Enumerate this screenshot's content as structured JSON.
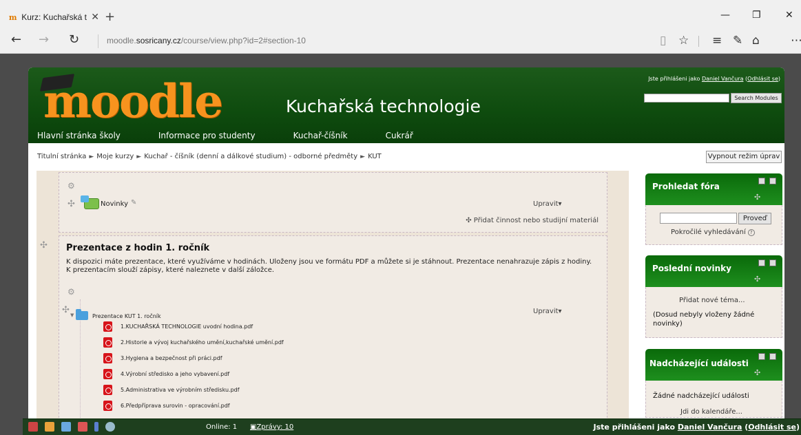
{
  "browser": {
    "tab_title": "Kurz: Kuchařská technol",
    "tab_favicon_text": "m",
    "url_prefix": "moodle.",
    "url_domain": "sosricany.cz",
    "url_path": "/course/view.php?id=2#section-10"
  },
  "header": {
    "logo_text": "moodle",
    "site_title": "Kuchařská technologie",
    "login_prefix": "Jste přihlášeni jako ",
    "user_name": "Daniel Vančura",
    "logout_label": "Odhlásit se",
    "search_button": "Search Modules",
    "menu": [
      "Hlavní stránka školy",
      "Informace pro studenty",
      "Kuchař-číšník",
      "Cukrář"
    ]
  },
  "breadcrumb": [
    "Titulní stránka",
    "Moje kurzy",
    "Kuchař - číšník (denní a dálkové studium) - odborné předměty",
    "KUT"
  ],
  "breadcrumb_sep": "►",
  "edit_mode_button": "Vypnout režim úprav",
  "section0": {
    "forum_name": "Novinky",
    "edit_label": "Upravit",
    "add_activity": "Přidat činnost nebo studijní materiál"
  },
  "section1": {
    "title": "Prezentace z hodin 1. ročník",
    "summary": "K dispozici máte prezentace, které využíváme v hodinách. Uloženy jsou ve formátu PDF a můžete si je stáhnout. Prezentace nenahrazuje zápis z hodiny. K prezentacím slouží zápisy, které naleznete v další záložce.",
    "folder_name": "Prezentace KUT 1. ročník",
    "edit_label": "Upravit",
    "files": [
      "1.KUCHAŘSKÁ TECHNOLOGIE uvodní hodina.pdf",
      "2.Historie a vývoj kuchařského umění,kuchařské umění.pdf",
      "3.Hygiena a bezpečnost při práci.pdf",
      "4.Výrobní středisko a jeho vybavení.pdf",
      "5.Administrativa ve výrobním středisku.pdf",
      "6.Předpříprava surovin - opracování.pdf"
    ]
  },
  "blocks": {
    "search_forums": {
      "title": "Prohledat fóra",
      "button": "Proveď",
      "advanced": "Pokročilé vyhledávání"
    },
    "latest_news": {
      "title": "Poslední novinky",
      "add_topic": "Přidat nové téma...",
      "empty": "(Dosud nebyly vloženy žádné novinky)"
    },
    "upcoming": {
      "title": "Nadcházející události",
      "empty": "Žádné nadcházející události",
      "calendar_link": "Jdi do kalendáře..."
    }
  },
  "footer": {
    "online": "Online: 1",
    "messages": "Zprávy: 10",
    "login_prefix": "Jste přihlášeni jako ",
    "user_name": "Daniel Vančura",
    "logout_label": "Odhlásit se"
  }
}
